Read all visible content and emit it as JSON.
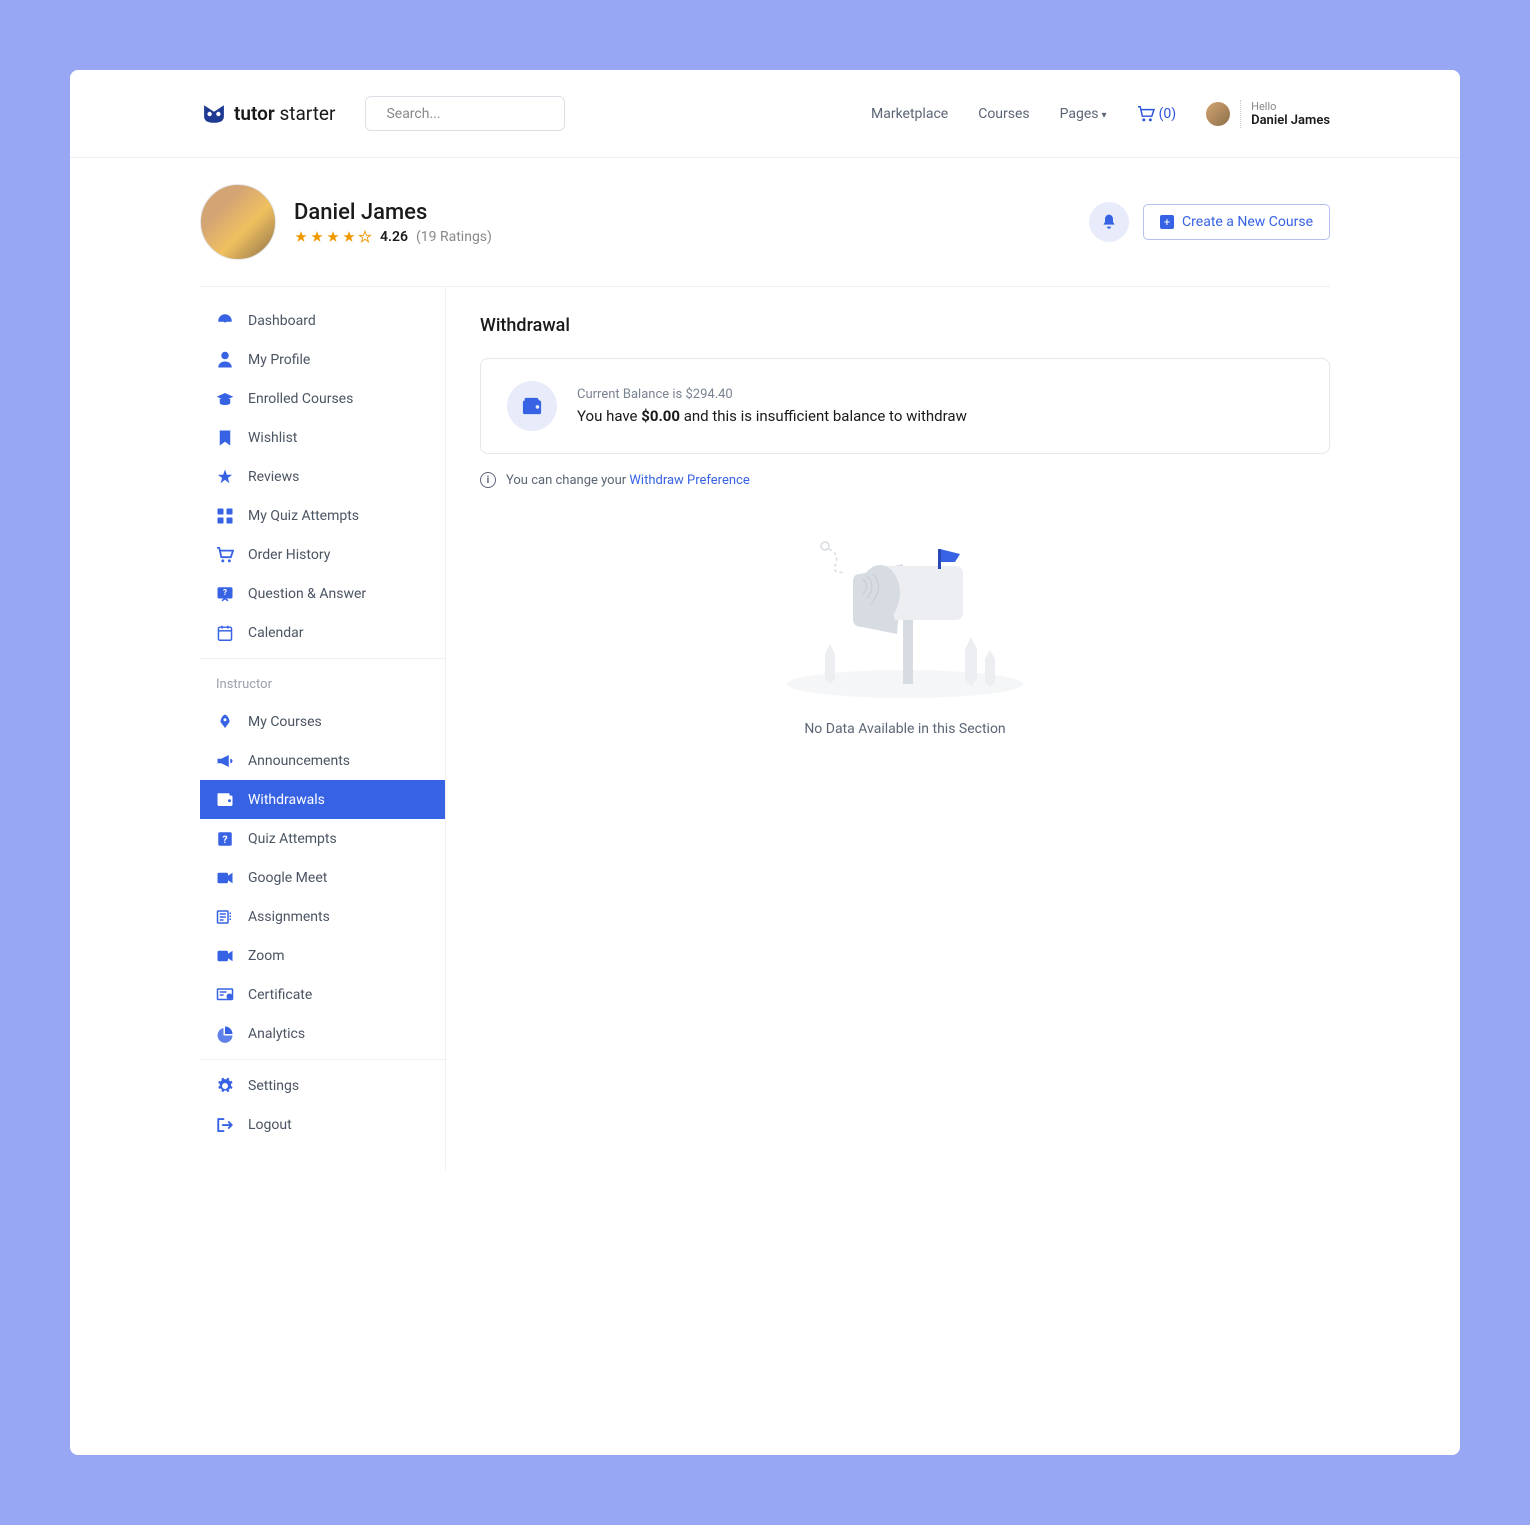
{
  "logo": {
    "text1": "tutor",
    "text2": "starter"
  },
  "search": {
    "placeholder": "Search..."
  },
  "nav": {
    "marketplace": "Marketplace",
    "courses": "Courses",
    "pages": "Pages",
    "cart_count": "(0)"
  },
  "user": {
    "greeting": "Hello",
    "name": "Daniel James"
  },
  "profile": {
    "name": "Daniel James",
    "rating": "4.26",
    "rating_count": "(19 Ratings)"
  },
  "actions": {
    "create_course": "Create a New Course"
  },
  "sidebar": {
    "student": {
      "dashboard": "Dashboard",
      "my_profile": "My Profile",
      "enrolled_courses": "Enrolled Courses",
      "wishlist": "Wishlist",
      "reviews": "Reviews",
      "my_quiz_attempts": "My Quiz Attempts",
      "order_history": "Order History",
      "question_answer": "Question & Answer",
      "calendar": "Calendar"
    },
    "instructor_heading": "Instructor",
    "instructor": {
      "my_courses": "My Courses",
      "announcements": "Announcements",
      "withdrawals": "Withdrawals",
      "quiz_attempts": "Quiz Attempts",
      "google_meet": "Google Meet",
      "assignments": "Assignments",
      "zoom": "Zoom",
      "certificate": "Certificate",
      "analytics": "Analytics"
    },
    "footer": {
      "settings": "Settings",
      "logout": "Logout"
    }
  },
  "main": {
    "title": "Withdrawal",
    "balance_label": "Current Balance is $294.40",
    "balance_msg_1": "You have ",
    "balance_msg_amount": "$0.00",
    "balance_msg_2": " and this is insufficient balance to withdraw",
    "pref_text": "You can change your ",
    "pref_link": "Withdraw Preference",
    "empty": "No Data Available in this Section"
  }
}
